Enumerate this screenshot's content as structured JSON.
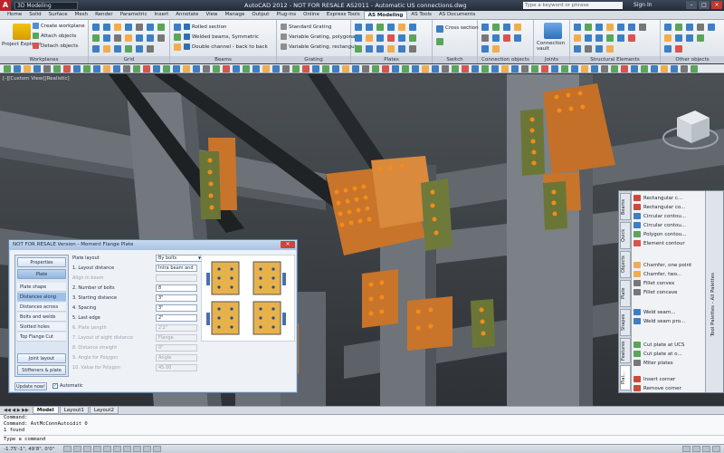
{
  "titlebar": {
    "workspace": "3D Modeling",
    "title": "AutoCAD 2012 - NOT FOR RESALE    AS2011 - Automatic US connections.dwg",
    "search_placeholder": "Type a keyword or phrase",
    "signin": "Sign In"
  },
  "tabs": [
    "Home",
    "Solid",
    "Surface",
    "Mesh",
    "Render",
    "Parametric",
    "Insert",
    "Annotate",
    "View",
    "Manage",
    "Output",
    "Plug-ins",
    "Online",
    "Express Tools",
    "AS Modeling",
    "AS Tools",
    "AS Documents"
  ],
  "active_tab": "AS Modeling",
  "ribbon": {
    "project_explorer": "Project Explorer",
    "workplane_items": [
      "Create workplane",
      "Attach objects",
      "Detach objects"
    ],
    "beams_items": [
      "Rolled section",
      "Welded beams, Symmetric",
      "Double channel - back to back"
    ],
    "grating_items": [
      "Standard Grating",
      "Variable Grating, polygonal",
      "Variable Grating, rectangular"
    ],
    "cross_section": "Cross section",
    "connection_vault": "Connection vault",
    "group_labels": [
      "Workplanes",
      "Grid",
      "Beams",
      "Grating",
      "Plates",
      "Switch",
      "Connection objects",
      "Joints",
      "Structural Elements",
      "Other objects"
    ]
  },
  "viewport": {
    "label": "[-][Custom View][Realistic]"
  },
  "dialog": {
    "title": "NOT FOR RESALE Version - Moment Flange Plate",
    "nav_top": [
      "Properties",
      "Plate"
    ],
    "nav_items": [
      "Plate shape",
      "Distances along",
      "Distances across",
      "Bolts and welds",
      "Slotted holes",
      "Top Flange Cut"
    ],
    "nav_bottom": [
      "Joint layout",
      "Stiffeners & plate"
    ],
    "section_label": "Plate layout",
    "section_value": "By bolts",
    "fields": [
      {
        "label": "1. Layout distance",
        "value": "Intra beam and",
        "dim": false
      },
      {
        "label": "Align in beam",
        "value": "",
        "dim": true
      },
      {
        "label": "2. Number of bolts",
        "value": "8",
        "dim": false
      },
      {
        "label": "3. Starting distance",
        "value": "3\"",
        "dim": false
      },
      {
        "label": "4. Spacing",
        "value": "3\"",
        "dim": false
      },
      {
        "label": "5. Last edge",
        "value": "2\"",
        "dim": false
      },
      {
        "label": "6. Plate Length",
        "value": "2'2\"",
        "dim": true
      },
      {
        "label": "7. Layout of eight distance",
        "value": "Flange",
        "dim": true
      },
      {
        "label": "8. Distance straight",
        "value": "0\"",
        "dim": true
      },
      {
        "label": "9. Angle for Polygon",
        "value": "Angle",
        "dim": true
      },
      {
        "label": "10. Value for Polygon",
        "value": "45.00",
        "dim": true
      }
    ],
    "update_button": "Update now!",
    "automatic_label": "Automatic"
  },
  "palette": {
    "title": "Tool Palettes - All Palettes",
    "tabs": [
      "Beams",
      "Quick",
      "Objects",
      "Plate",
      "Shapes",
      "Features",
      "Plat..."
    ],
    "items": [
      "Rectangular c...",
      "Rectangular co...",
      "Circular contou...",
      "Circular contou...",
      "Polygon contou...",
      "Element contour",
      "Chamfer, one point",
      "Chamfer, two...",
      "Fillet convex",
      "Fillet concave",
      "Weld seam...",
      "Weld seam pro...",
      "Cut plate at UCS",
      "Cut plate at o...",
      "Miter plates",
      "Insert corner",
      "Remove corner"
    ]
  },
  "layout_tabs": [
    "Model",
    "Layout1",
    "Layout2"
  ],
  "command": {
    "lines": [
      "Command:",
      "Command: AstMcConnAutoidit 0",
      "1 found"
    ],
    "prompt": "Type a command"
  },
  "status": {
    "coords": "-1.75'-1\", 49'8\", 0'0\""
  }
}
